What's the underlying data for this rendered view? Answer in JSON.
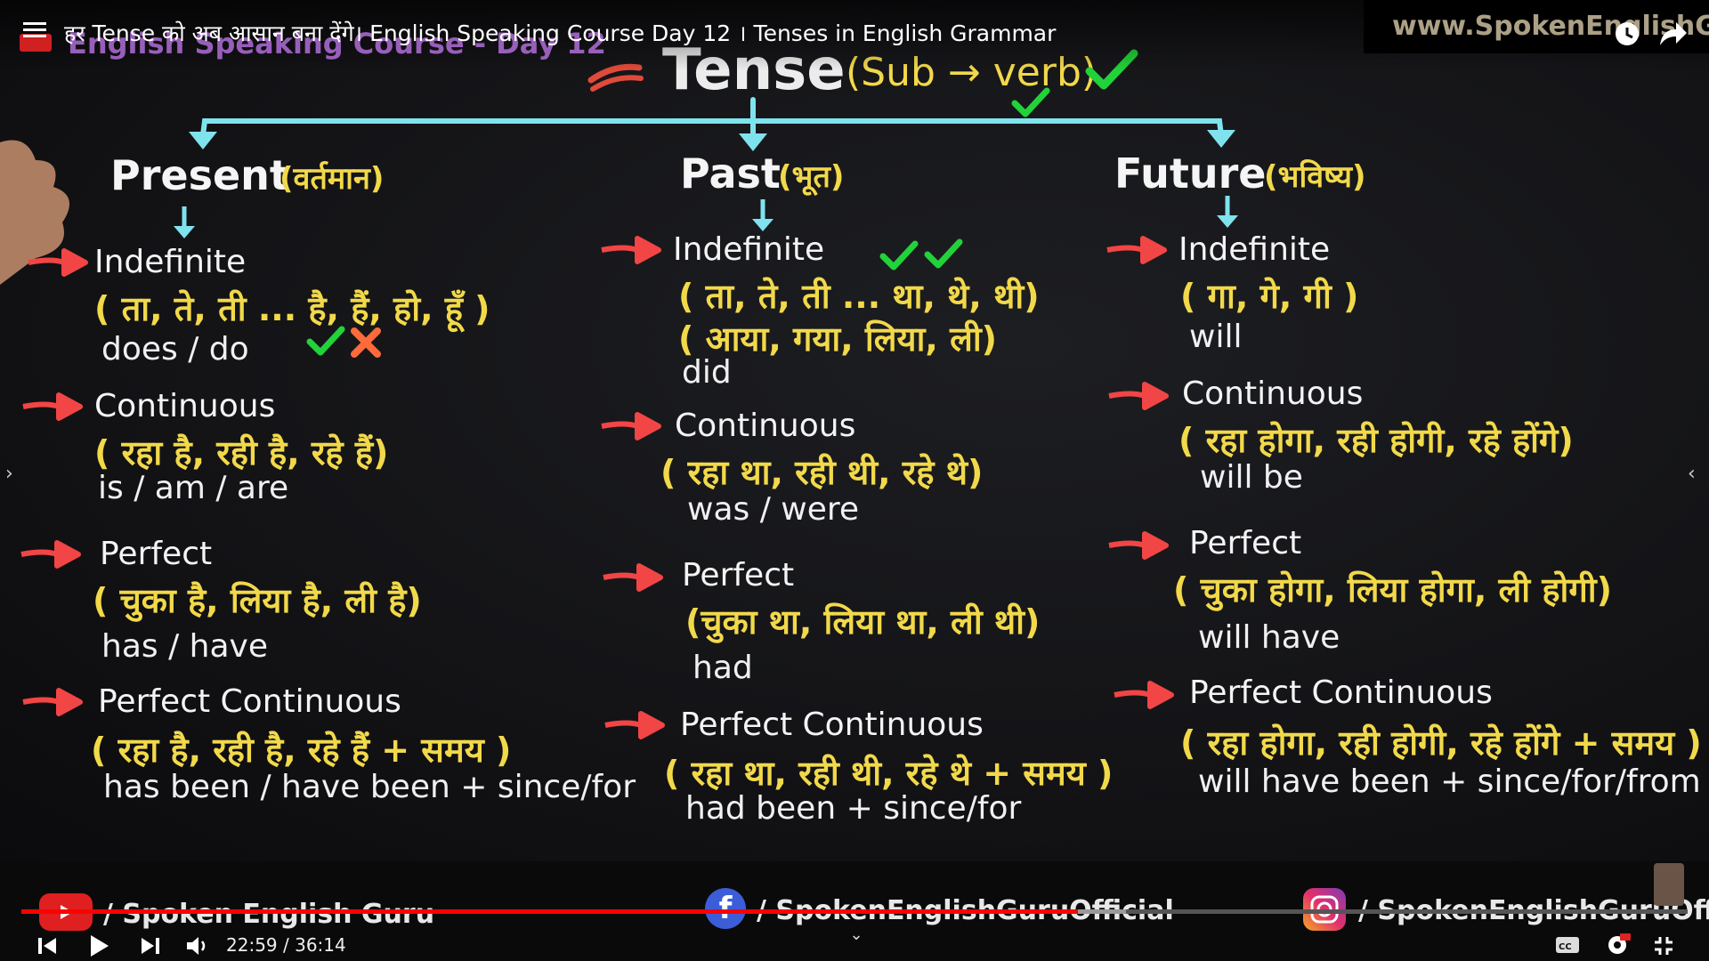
{
  "video": {
    "title": "हर Tense को अब आसान बना देंगे। English Speaking Course Day 12 । Tenses in English Grammar",
    "course_label": "English Speaking Course - Day 12",
    "website": "www.SpokenEnglishGuru",
    "time_current": "22:59",
    "time_total": "36:14",
    "time_display": "22:59 / 36:14",
    "progress": 0.634,
    "buffered": 0.663
  },
  "board": {
    "tense_title": "Tense",
    "tense_subtitle": "(Sub → verb)",
    "columns": [
      {
        "heading": "Present",
        "heading_hindi": "(वर्तमान)",
        "sections": [
          {
            "name": "Indefinite",
            "hindi": "( ता, ते, ती ... है, हैं, हो, हूँ )",
            "english": "does / do"
          },
          {
            "name": "Continuous",
            "hindi": "( रहा है, रही है, रहे हैं)",
            "english": "is / am / are"
          },
          {
            "name": "Perfect",
            "hindi": "( चुका है, लिया है, ली है)",
            "english": "has / have"
          },
          {
            "name": "Perfect Continuous",
            "hindi": "( रहा है, रही है, रहे हैं + समय )",
            "english": "has been / have been + since/for"
          }
        ]
      },
      {
        "heading": "Past",
        "heading_hindi": "(भूत)",
        "sections": [
          {
            "name": "Indefinite",
            "hindi": "( ता, ते, ती ... था, थे, थी)",
            "hindi2": "( आया, गया, लिया, ली)",
            "english": "did"
          },
          {
            "name": "Continuous",
            "hindi": "( रहा था, रही थी, रहे थे)",
            "english": "was / were"
          },
          {
            "name": "Perfect",
            "hindi": "(चुका था, लिया था, ली थी)",
            "english": "had"
          },
          {
            "name": "Perfect Continuous",
            "hindi": "( रहा था, रही थी, रहे थे + समय )",
            "english": "had been + since/for"
          }
        ]
      },
      {
        "heading": "Future",
        "heading_hindi": "(भविष्य)",
        "sections": [
          {
            "name": "Indefinite",
            "hindi": "( गा, गे, गी )",
            "english": "will"
          },
          {
            "name": "Continuous",
            "hindi": "( रहा होगा, रही होगी, रहे होंगे)",
            "english": "will be"
          },
          {
            "name": "Perfect",
            "hindi": "( चुका होगा, लिया होगा, ली होगी)",
            "english": "will have"
          },
          {
            "name": "Perfect Continuous",
            "hindi": "( रहा होगा, रही होगी, रहे होंगे + समय )",
            "english": "will have been + since/for/from"
          }
        ]
      }
    ]
  },
  "socials": {
    "youtube": "/ Spoken English Guru",
    "facebook": "/ SpokenEnglishGuruOfficial",
    "instagram": "/ SpokenEnglishGuruOfficial"
  },
  "colors": {
    "accent_arrow": "#f24545",
    "highlight_yellow": "#f2d94a",
    "connector_cyan": "#7fe3ee",
    "check_green": "#22d23a",
    "progress_red": "#ff0000"
  }
}
